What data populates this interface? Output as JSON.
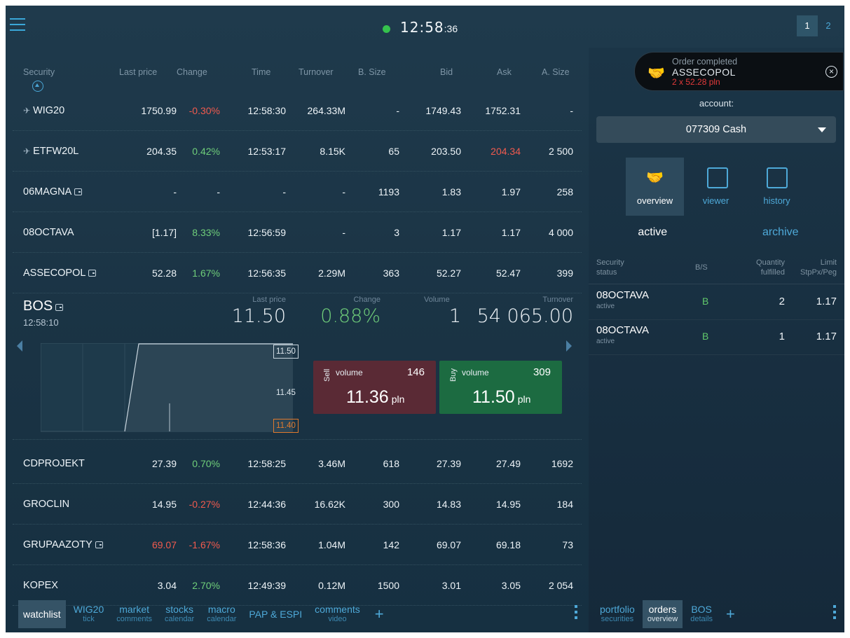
{
  "clock": {
    "main": "12:58",
    "sec": ":36"
  },
  "page_tabs": [
    "1",
    "2"
  ],
  "table": {
    "headers": [
      "Security",
      "Last price",
      "Change",
      "Time",
      "Turnover",
      "B. Size",
      "Bid",
      "Ask",
      "A. Size"
    ],
    "rows": [
      {
        "security": "WIG20",
        "pinned": true,
        "portfolio": false,
        "last": "1750.99",
        "change": "-0.30%",
        "change_dir": "neg",
        "last_dir": "",
        "time": "12:58:30",
        "turnover": "264.33M",
        "bsize": "-",
        "bid": "1749.43",
        "ask": "1752.31",
        "ask_dir": "",
        "asize": "-"
      },
      {
        "security": "ETFW20L",
        "pinned": true,
        "portfolio": false,
        "last": "204.35",
        "change": "0.42%",
        "change_dir": "pos",
        "last_dir": "",
        "time": "12:53:17",
        "turnover": "8.15K",
        "bsize": "65",
        "bid": "203.50",
        "ask": "204.34",
        "ask_dir": "neg",
        "asize": "2 500"
      },
      {
        "security": "06MAGNA",
        "pinned": false,
        "portfolio": true,
        "last": "-",
        "change": "-",
        "change_dir": "",
        "last_dir": "",
        "time": "-",
        "turnover": "-",
        "bsize": "1193",
        "bid": "1.83",
        "ask": "1.97",
        "ask_dir": "",
        "asize": "258"
      },
      {
        "security": "08OCTAVA",
        "pinned": false,
        "portfolio": false,
        "last": "[1.17]",
        "change": "8.33%",
        "change_dir": "pos",
        "last_dir": "",
        "time": "12:56:59",
        "turnover": "-",
        "bsize": "3",
        "bid": "1.17",
        "ask": "1.17",
        "ask_dir": "",
        "asize": "4 000"
      },
      {
        "security": "ASSECOPOL",
        "pinned": false,
        "portfolio": true,
        "last": "52.28",
        "change": "1.67%",
        "change_dir": "pos",
        "last_dir": "",
        "time": "12:56:35",
        "turnover": "2.29M",
        "bsize": "363",
        "bid": "52.27",
        "ask": "52.47",
        "ask_dir": "",
        "asize": "399"
      }
    ],
    "rows_after": [
      {
        "security": "CDPROJEKT",
        "pinned": false,
        "portfolio": false,
        "last": "27.39",
        "change": "0.70%",
        "change_dir": "pos",
        "last_dir": "",
        "time": "12:58:25",
        "turnover": "3.46M",
        "bsize": "618",
        "bid": "27.39",
        "ask": "27.49",
        "ask_dir": "",
        "asize": "1692"
      },
      {
        "security": "GROCLIN",
        "pinned": false,
        "portfolio": false,
        "last": "14.95",
        "change": "-0.27%",
        "change_dir": "neg",
        "last_dir": "",
        "time": "12:44:36",
        "turnover": "16.62K",
        "bsize": "300",
        "bid": "14.83",
        "ask": "14.95",
        "ask_dir": "",
        "asize": "184"
      },
      {
        "security": "GRUPAAZOTY",
        "pinned": false,
        "portfolio": true,
        "last": "69.07",
        "change": "-1.67%",
        "change_dir": "neg",
        "last_dir": "neg",
        "time": "12:58:36",
        "turnover": "1.04M",
        "bsize": "142",
        "bid": "69.07",
        "ask": "69.18",
        "ask_dir": "",
        "asize": "73"
      },
      {
        "security": "KOPEX",
        "pinned": false,
        "portfolio": false,
        "last": "3.04",
        "change": "2.70%",
        "change_dir": "pos",
        "last_dir": "",
        "time": "12:49:39",
        "turnover": "0.12M",
        "bsize": "1500",
        "bid": "3.01",
        "ask": "3.05",
        "ask_dir": "",
        "asize": "2 054"
      }
    ]
  },
  "detail": {
    "name": "BOS",
    "time": "12:58:10",
    "labels": {
      "last": "Last price",
      "change": "Change",
      "volume": "Volume",
      "turnover": "Turnover"
    },
    "last": "11.50",
    "change": "0.88%",
    "volume": "1",
    "turnover": "54 065.00",
    "ticks": {
      "high": "11.50",
      "mid": "11.45",
      "low": "11.40"
    },
    "sell": {
      "side": "Sell",
      "label": "volume",
      "volume": "146",
      "price": "11.36",
      "unit": "pln"
    },
    "buy": {
      "side": "Buy",
      "label": "volume",
      "volume": "309",
      "price": "11.50",
      "unit": "pln"
    }
  },
  "bottom_tabs": [
    {
      "label": "watchlist",
      "sub": "",
      "active": true
    },
    {
      "label": "WIG20",
      "sub": "tick",
      "active": false
    },
    {
      "label": "market",
      "sub": "comments",
      "active": false
    },
    {
      "label": "stocks",
      "sub": "calendar",
      "active": false
    },
    {
      "label": "macro",
      "sub": "calendar",
      "active": false
    },
    {
      "label": "PAP & ESPI",
      "sub": "",
      "active": false
    },
    {
      "label": "comments",
      "sub": "video",
      "active": false
    }
  ],
  "toast": {
    "title": "Order completed",
    "security": "ASSECOPOL",
    "detail": "2 x 52.28 pln"
  },
  "account": {
    "label": "account:",
    "value": "077309 Cash"
  },
  "order_tabs": [
    {
      "label": "overview",
      "icon": "handshake-icon",
      "active": true
    },
    {
      "label": "viewer",
      "icon": "document-clock-icon",
      "active": false
    },
    {
      "label": "history",
      "icon": "calendar-handshake-icon",
      "active": false
    }
  ],
  "segments": {
    "active": "active",
    "archive": "archive"
  },
  "orders_head": {
    "security": "Security",
    "status": "status",
    "bs": "B/S",
    "qty1": "Quantity",
    "qty2": "fulfilled",
    "lim1": "Limit",
    "lim2": "StpPx/Peg"
  },
  "orders": [
    {
      "name": "08OCTAVA",
      "status": "active",
      "bs": "B",
      "qty": "2",
      "limit": "1.17"
    },
    {
      "name": "08OCTAVA",
      "status": "active",
      "bs": "B",
      "qty": "1",
      "limit": "1.17"
    }
  ],
  "right_tabs": [
    {
      "label": "portfolio",
      "sub": "securities",
      "active": false
    },
    {
      "label": "orders",
      "sub": "overview",
      "active": true
    },
    {
      "label": "BOS",
      "sub": "details",
      "active": false
    }
  ],
  "colors": {
    "accent": "#4ea9d8",
    "positive": "#6fce7a",
    "negative": "#f15a4e",
    "sell_bg": "#5a2a35",
    "buy_bg": "#1c6b41",
    "status_ok": "#35c24d"
  }
}
